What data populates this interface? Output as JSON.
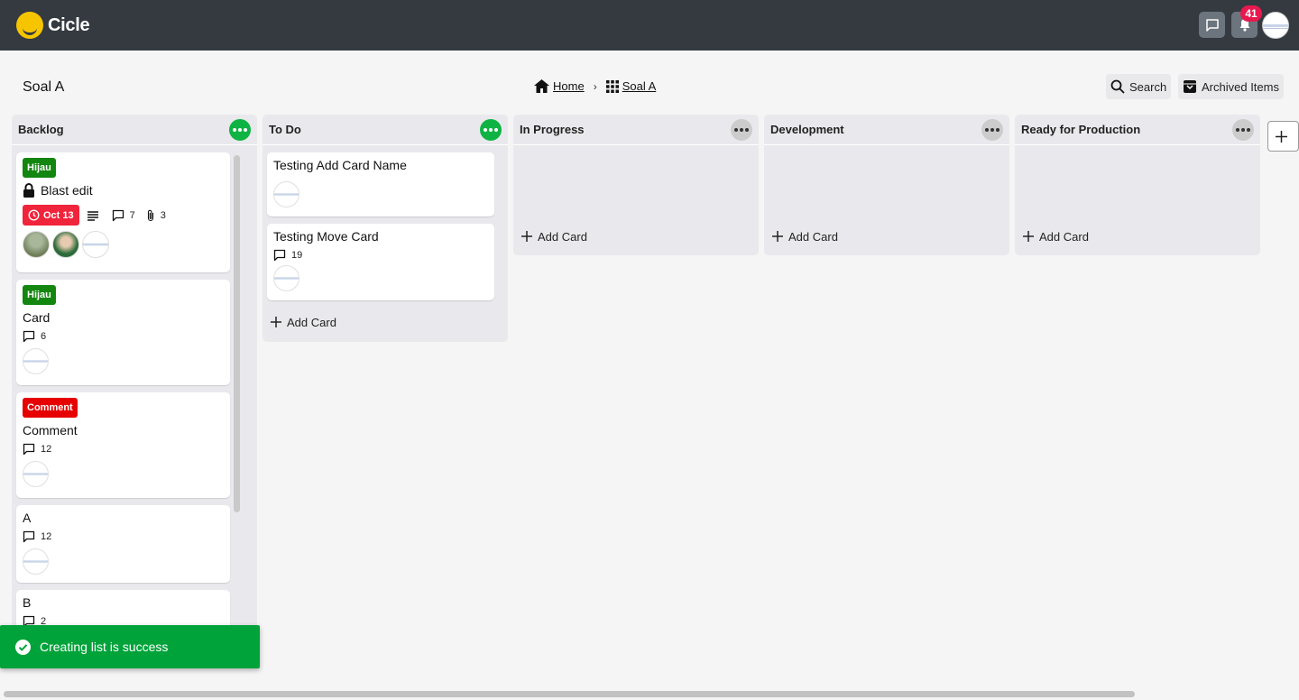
{
  "app": {
    "name": "Cicle"
  },
  "nav": {
    "notification_count": "41"
  },
  "header": {
    "board_title": "Soal A",
    "breadcrumb": {
      "home": "Home",
      "separator": "›",
      "board": "Soal A"
    },
    "search_label": "Search",
    "archived_label": "Archived Items"
  },
  "colors": {
    "topbar": "#343a40",
    "accent_green": "#0fb343",
    "tag_green": "#12860e",
    "tag_red": "#e60000",
    "due_red": "#f0243b",
    "toast": "#00a33a"
  },
  "lists": [
    {
      "title": "Backlog",
      "cards": [
        {
          "tag": "Hijau",
          "tag_color": "#12860e",
          "title": "Blast edit",
          "locked": true,
          "due": "Oct 13",
          "has_description": true,
          "comments": "7",
          "attachments": "3"
        },
        {
          "tag": "Hijau",
          "tag_color": "#12860e",
          "title": "Card",
          "comments": "6"
        },
        {
          "tag": "Comment",
          "tag_color": "#e60000",
          "title": "Comment",
          "comments": "12"
        },
        {
          "title": "A",
          "comments": "12"
        },
        {
          "title": "B",
          "comments": "2"
        }
      ]
    },
    {
      "title": "To Do",
      "cards": [
        {
          "title": "Testing Add Card Name"
        },
        {
          "title": "Testing Move Card",
          "comments": "19"
        }
      ],
      "add_card": "Add Card"
    },
    {
      "title": "In Progress",
      "add_card": "Add Card"
    },
    {
      "title": "Development",
      "add_card": "Add Card"
    },
    {
      "title": "Ready for Production",
      "add_card": "Add Card"
    }
  ],
  "toast": {
    "message": "Creating list is success"
  }
}
